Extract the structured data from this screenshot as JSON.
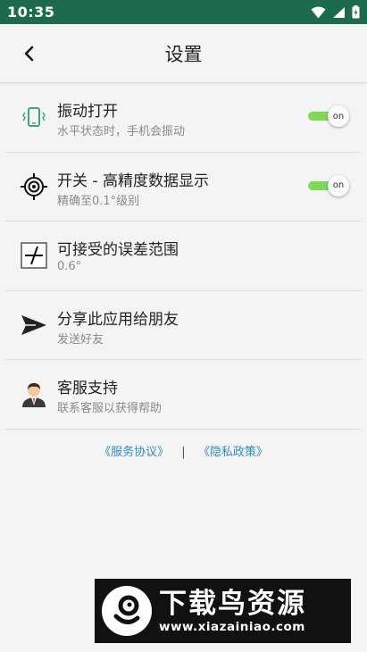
{
  "status_bar": {
    "time": "10:35"
  },
  "header": {
    "title": "设置"
  },
  "settings": [
    {
      "title": "振动打开",
      "subtitle": "水平状态时，手机会振动",
      "icon": "vibrate-phone-icon",
      "toggle": "on"
    },
    {
      "title": "开关 - 高精度数据显示",
      "subtitle": "精确至0.1°级别",
      "icon": "crosshair-target-icon",
      "toggle": "on"
    },
    {
      "title": "可接受的误差范围",
      "subtitle": "0.6°",
      "icon": "tolerance-angle-icon"
    },
    {
      "title": "分享此应用给朋友",
      "subtitle": "发送好友",
      "icon": "send-share-icon"
    },
    {
      "title": "客服支持",
      "subtitle": "联系客服以获得帮助",
      "icon": "customer-service-avatar-icon"
    }
  ],
  "footer": {
    "service_agreement": "《服务协议》",
    "separator": "|",
    "privacy_policy": "《隐私政策》"
  },
  "watermark": {
    "brand": "下载鸟资源",
    "url": "www.xiazainiao.com"
  },
  "colors": {
    "status_bar": "#1e6b4c",
    "toggle_on": "#7ed957",
    "link": "#2e8bbd",
    "accent_green": "#3aa876"
  }
}
